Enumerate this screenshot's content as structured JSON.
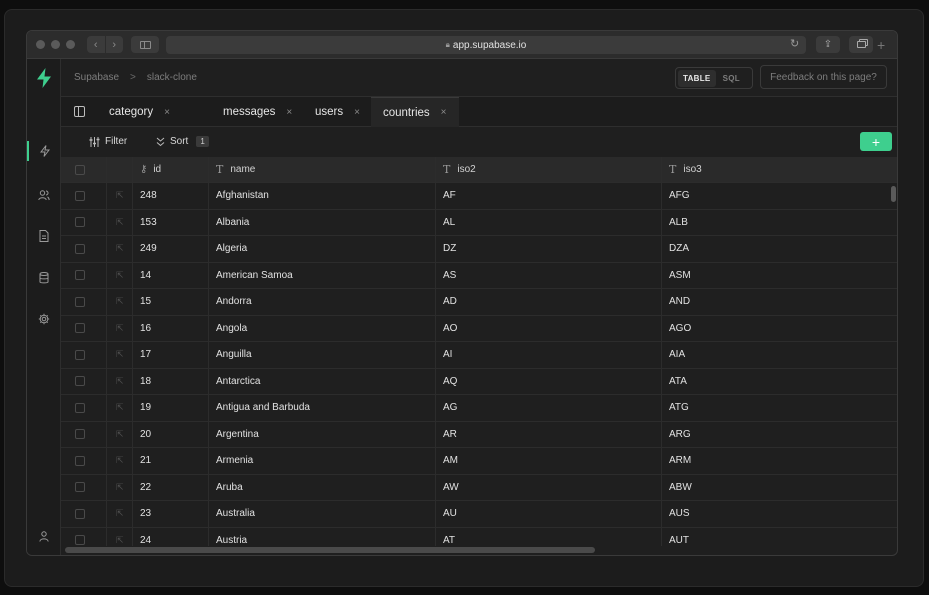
{
  "browser": {
    "url": "app.supabase.io",
    "lock_icon": "lock-icon",
    "back_icon": "chevron-left-icon",
    "forward_icon": "chevron-right-icon"
  },
  "rail": {
    "logo_color": "#3ecf8e",
    "items": [
      "bolt-icon",
      "users-icon",
      "document-icon",
      "database-icon",
      "gear-icon"
    ],
    "bottom": "user-icon"
  },
  "header": {
    "breadcrumb": [
      "Supabase",
      "slack-clone"
    ],
    "separator": ">",
    "view_table": "TABLE",
    "view_sql": "SQL",
    "feedback": "Feedback on this page?"
  },
  "tabs": [
    {
      "label": "category",
      "close": "×"
    },
    {
      "label": "messages",
      "close": "×"
    },
    {
      "label": "users",
      "close": "×"
    },
    {
      "label": "countries",
      "close": "×"
    }
  ],
  "toolbar": {
    "filter": "Filter",
    "sort": "Sort",
    "sort_count": "1",
    "add": "+"
  },
  "table": {
    "columns": [
      {
        "label": "id",
        "icon": "key-icon"
      },
      {
        "label": "name",
        "icon": "text-type-icon"
      },
      {
        "label": "iso2",
        "icon": "text-type-icon"
      },
      {
        "label": "iso3",
        "icon": "text-type-icon"
      }
    ],
    "type_glyph": "T",
    "rows": [
      [
        "248",
        "Afghanistan",
        "AF",
        "AFG"
      ],
      [
        "153",
        "Albania",
        "AL",
        "ALB"
      ],
      [
        "249",
        "Algeria",
        "DZ",
        "DZA"
      ],
      [
        "14",
        "American Samoa",
        "AS",
        "ASM"
      ],
      [
        "15",
        "Andorra",
        "AD",
        "AND"
      ],
      [
        "16",
        "Angola",
        "AO",
        "AGO"
      ],
      [
        "17",
        "Anguilla",
        "AI",
        "AIA"
      ],
      [
        "18",
        "Antarctica",
        "AQ",
        "ATA"
      ],
      [
        "19",
        "Antigua and Barbuda",
        "AG",
        "ATG"
      ],
      [
        "20",
        "Argentina",
        "AR",
        "ARG"
      ],
      [
        "21",
        "Armenia",
        "AM",
        "ARM"
      ],
      [
        "22",
        "Aruba",
        "AW",
        "ABW"
      ],
      [
        "23",
        "Australia",
        "AU",
        "AUS"
      ],
      [
        "24",
        "Austria",
        "AT",
        "AUT"
      ]
    ]
  },
  "colors": {
    "accent": "#3ecf8e",
    "background": "#1f1f1f",
    "header_row": "#2a2a2a"
  }
}
